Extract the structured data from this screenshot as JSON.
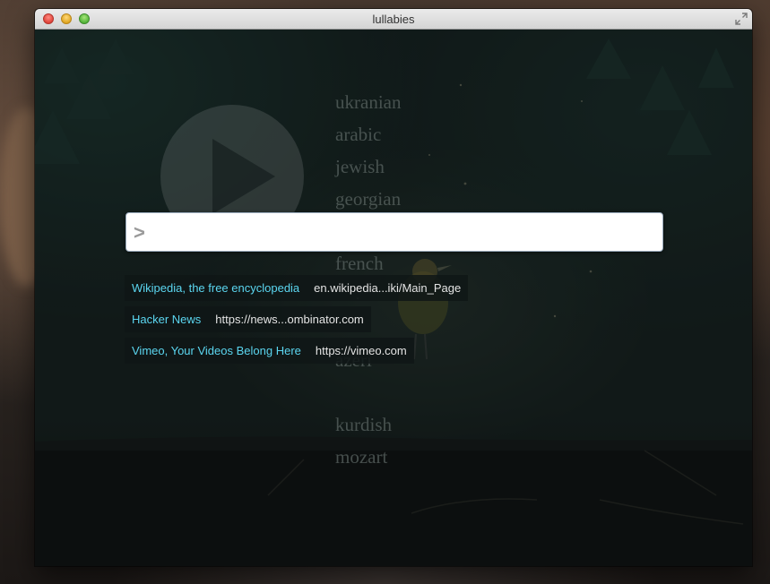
{
  "window": {
    "title": "lullabies"
  },
  "search": {
    "prompt": ">",
    "value": "",
    "placeholder": ""
  },
  "languages": [
    "ukranian",
    "arabic",
    "jewish",
    "georgian",
    "",
    "french",
    "",
    "",
    "azeri",
    "",
    "kurdish",
    "mozart"
  ],
  "results": [
    {
      "title": "Wikipedia, the free encyclopedia",
      "url": "en.wikipedia...iki/Main_Page"
    },
    {
      "title": "Hacker News",
      "url": "https://news...ombinator.com"
    },
    {
      "title": "Vimeo, Your Videos Belong Here",
      "url": "https://vimeo.com"
    }
  ],
  "icons": {
    "play": "play-icon",
    "fullscreen": "fullscreen-icon"
  },
  "colors": {
    "link": "#5bd6f0",
    "url": "#e4e4e4"
  }
}
